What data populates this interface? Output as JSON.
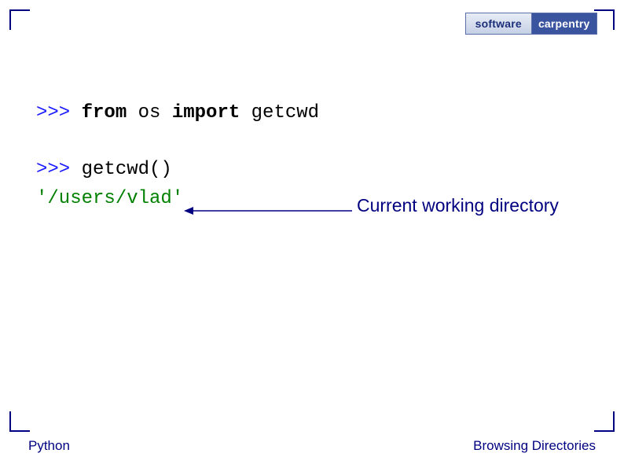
{
  "logo": {
    "left": "software",
    "right": "carpentry"
  },
  "code": {
    "line1_prompt": ">>> ",
    "line1_kw1": "from",
    "line1_mid": " os ",
    "line1_kw2": "import",
    "line1_tail": " getcwd",
    "line2_prompt": ">>> ",
    "line2_call": "getcwd()",
    "line3_output": "'/users/vlad'"
  },
  "annotation": "Current working directory",
  "footer": {
    "left": "Python",
    "right": "Browsing Directories"
  },
  "colors": {
    "navy": "#000080",
    "blue": "#1a1aff",
    "green": "#008000"
  }
}
